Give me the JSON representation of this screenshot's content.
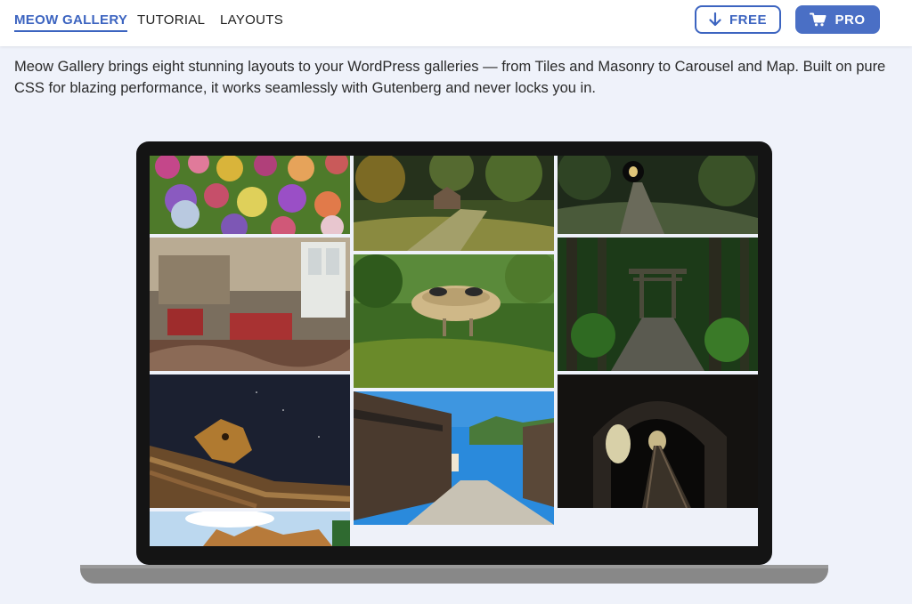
{
  "nav": {
    "brand": "MEOW GALLERY",
    "tutorial": "TUTORIAL",
    "layouts": "LAYOUTS"
  },
  "buttons": {
    "free": {
      "label": "FREE",
      "icon": "arrow-down-icon"
    },
    "pro": {
      "label": "PRO",
      "icon": "cart-icon"
    }
  },
  "intro": {
    "text": "Meow Gallery brings eight stunning layouts to your WordPress galleries — from Tiles and Masonry to Carousel and Map. Built on pure CSS for blazing performance, it works seamlessly with Gutenberg and never locks you in."
  },
  "colors": {
    "accent": "#3c64c0",
    "page_background": "#eff2fa",
    "laptop_frame": "#141414",
    "laptop_base": "#888888"
  },
  "gallery": {
    "images": [
      "hydrangea-garden-photo",
      "abandoned-room-photo",
      "night-roof-dragon-photo",
      "ornate-rooftop-photo",
      "forest-wooden-hut-photo",
      "futuro-house-forest-photo",
      "japanese-village-street-photo",
      "tunnel-path-forest-photo",
      "torii-gate-forest-stairs-photo",
      "railway-tunnel-photo"
    ]
  }
}
